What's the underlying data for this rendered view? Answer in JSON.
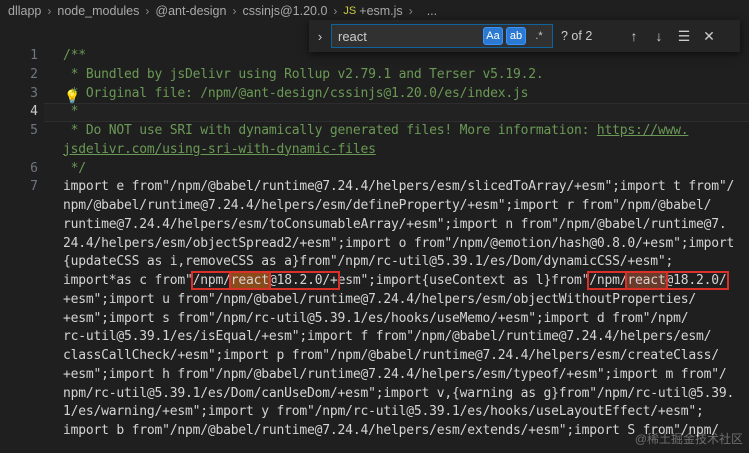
{
  "breadcrumb": {
    "items": [
      "dllapp",
      "node_modules",
      "@ant-design",
      "cssinjs@1.20.0"
    ],
    "file": "+esm.js",
    "ellipsis": "..."
  },
  "find": {
    "query": "react",
    "case_label": "Aa",
    "word_label": "ab",
    "regex_label": ".*",
    "count": "? of 2",
    "expand_icon": "chevron-right-icon"
  },
  "gutter": [
    "1",
    "2",
    "3",
    "4",
    "5",
    "6",
    "7",
    "",
    "",
    "",
    "",
    "",
    "",
    "",
    "",
    "",
    "",
    "",
    "",
    "",
    ""
  ],
  "code": {
    "l1": "/**",
    "l2": " * Bundled by jsDelivr using Rollup v2.79.1 and Terser v5.19.2.",
    "l3": " * Original file: /npm/@ant-design/cssinjs@1.20.0/es/index.js",
    "l4": " *",
    "l5a": " * Do NOT use SRI with dynamically generated files! More information: ",
    "l5b": "https://www.",
    "l5c": "jsdelivr.com/using-sri-with-dynamic-files",
    "l6": " */",
    "l7": "import e from\"/npm/@babel/runtime@7.24.4/helpers/esm/slicedToArray/+esm\";import t from\"/",
    "l8": "npm/@babel/runtime@7.24.4/helpers/esm/defineProperty/+esm\";import r from\"/npm/@babel/",
    "l9": "runtime@7.24.4/helpers/esm/toConsumableArray/+esm\";import n from\"/npm/@babel/runtime@7.",
    "l10": "24.4/helpers/esm/objectSpread2/+esm\";import o from\"/npm/@emotion/hash@0.8.0/+esm\";import",
    "l11": "{updateCSS as i,removeCSS as a}from\"/npm/rc-util@5.39.1/es/Dom/dynamicCSS/+esm\";",
    "l12a": "import*as c from\"",
    "l12b": "/npm/",
    "l12c": "react",
    "l12d": "@18.2.0/+",
    "l12e": "esm\";import{useContext as l}from\"",
    "l12f": "/npm/",
    "l12g": "react",
    "l12h": "@18.2.0/",
    "l13": "+esm\";import u from\"/npm/@babel/runtime@7.24.4/helpers/esm/objectWithoutProperties/",
    "l14": "+esm\";import s from\"/npm/rc-util@5.39.1/es/hooks/useMemo/+esm\";import d from\"/npm/",
    "l15": "rc-util@5.39.1/es/isEqual/+esm\";import f from\"/npm/@babel/runtime@7.24.4/helpers/esm/",
    "l16": "classCallCheck/+esm\";import p from\"/npm/@babel/runtime@7.24.4/helpers/esm/createClass/",
    "l17": "+esm\";import h from\"/npm/@babel/runtime@7.24.4/helpers/esm/typeof/+esm\";import m from\"/",
    "l18": "npm/rc-util@5.39.1/es/Dom/canUseDom/+esm\";import v,{warning as g}from\"/npm/rc-util@5.39.",
    "l19": "1/es/warning/+esm\";import y from\"/npm/rc-util@5.39.1/es/hooks/useLayoutEffect/+esm\";",
    "l20": "import b from\"/npm/@babel/runtime@7.24.4/helpers/esm/extends/+esm\";import S from\"/npm/"
  },
  "watermark": "@稀土掘金技术社区",
  "colors": {
    "background": "#1f1f1f",
    "comment": "#6a9955",
    "match_border": "#d9302a",
    "accent": "#0e639c"
  }
}
